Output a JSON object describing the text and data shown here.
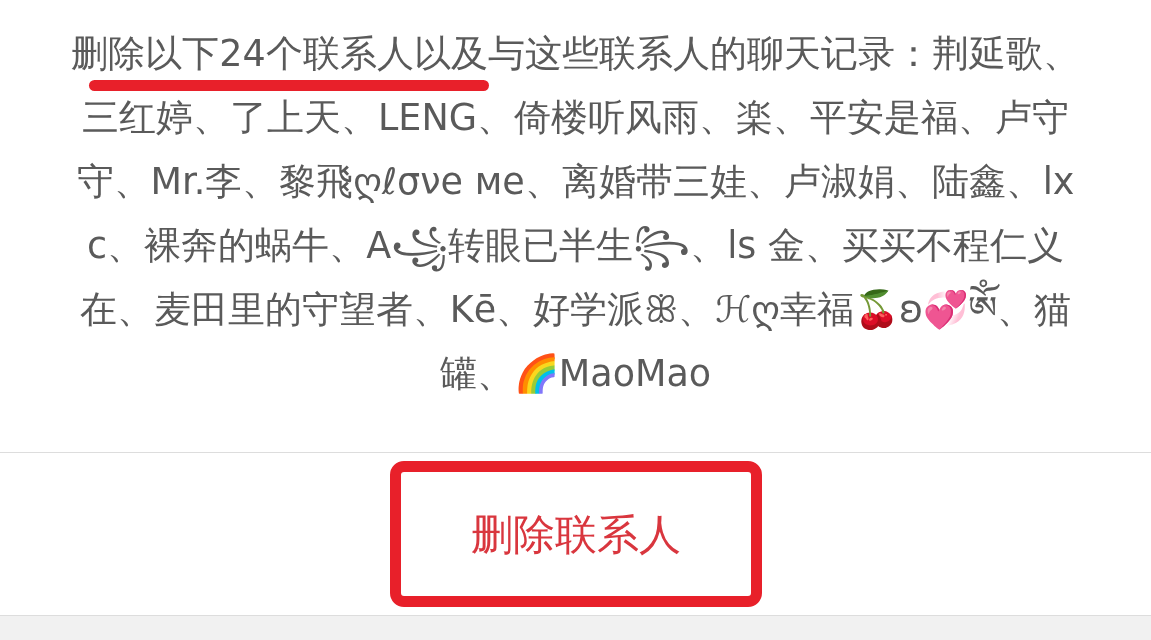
{
  "dialog": {
    "message": "删除以下24个联系人以及与这些联系人的聊天记录：荆延歌、三红婷、了上天、LENG、倚楼听风雨、楽、平安是福、卢守守、Mr.李、黎飛ღℓσνe мe、离婚带三娃、卢淑娟、陆鑫、lxc、裸奔的蜗牛、A꧁转眼已半生꧂、ls 金、买买不程仁义在、麦田里的守望者、Kē、好学派ꕥ、ℋღ幸福🍒ʚ💞ༀ、猫罐、🌈MaoMao",
    "confirm_button": "删除联系人"
  },
  "annotations": {
    "underline": {
      "color": "#e8202a"
    },
    "highlight_box": {
      "color": "#e8202a"
    }
  }
}
